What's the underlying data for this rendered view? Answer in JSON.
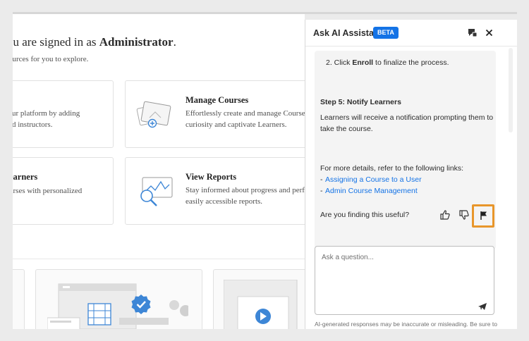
{
  "main": {
    "welcome_prefix": "ou are signed in as ",
    "welcome_role": "Administrator",
    "welcome_suffix": ".",
    "subtitle": "ources for you to explore.",
    "cards": [
      {
        "title": "",
        "desc1": "ur platform by adding",
        "desc2": "d instructors."
      },
      {
        "title": "Manage Courses",
        "desc1": "Effortlessly create and manage Courses",
        "desc2": "curiosity and captivate Learners."
      },
      {
        "title": "earners",
        "desc1": "urses with personalized",
        "desc2": ""
      },
      {
        "title": "View Reports",
        "desc1": "Stay informed about progress and perfo",
        "desc2": "easily accessible reports."
      }
    ]
  },
  "assistant": {
    "title": "Ask AI Assistant",
    "badge": "BETA",
    "messages": {
      "step_prefix": "2. Click ",
      "step_bold": "Enroll",
      "step_suffix": " to finalize the process.",
      "step5_heading": "Step 5: Notify Learners",
      "notify_line1": "Learners will receive a notification prompting them to",
      "notify_line2": "take the course.",
      "details": "For more details, refer to the following links:",
      "links": [
        "Assigning a Course to a User",
        "Admin Course Management"
      ],
      "feedback_question": "Are you finding this useful?"
    },
    "input_placeholder": "Ask a question...",
    "disclaimer": "AI-generated responses may be inaccurate or misleading. Be sure to"
  },
  "colors": {
    "accent": "#1473e6",
    "highlight": "#e8962b",
    "icon_blue": "#3d86d6"
  },
  "icons": [
    "chat-history-icon",
    "close-icon",
    "thumbs-up-icon",
    "thumbs-down-icon",
    "flag-icon",
    "send-icon",
    "verified-badge-icon",
    "play-icon",
    "film-icon",
    "search-chart-icon",
    "course-cards-icon"
  ]
}
